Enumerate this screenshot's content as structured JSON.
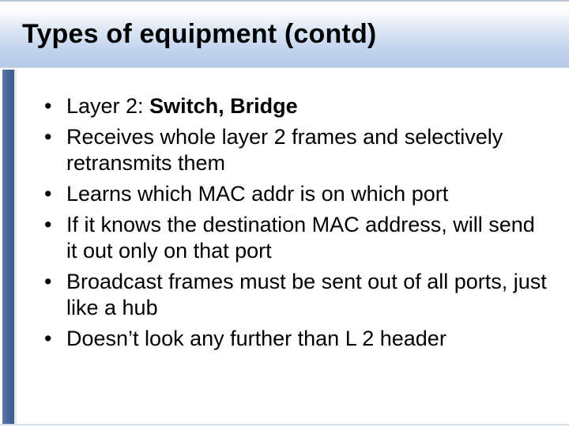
{
  "slide": {
    "title": "Types of equipment (contd)",
    "bullets": [
      {
        "pre": "Layer 2: ",
        "bold": "Switch, Bridge",
        "rest": ""
      },
      {
        "text": "Receives whole layer 2 frames and selectively retransmits them"
      },
      {
        "text": "Learns which MAC addr is on which port"
      },
      {
        "text": "If it knows the destination MAC address, will send it out only on that port"
      },
      {
        "text": "Broadcast frames must be sent out of all ports, just like a hub"
      },
      {
        "text": "Doesn’t look any further than L 2 header"
      }
    ]
  }
}
